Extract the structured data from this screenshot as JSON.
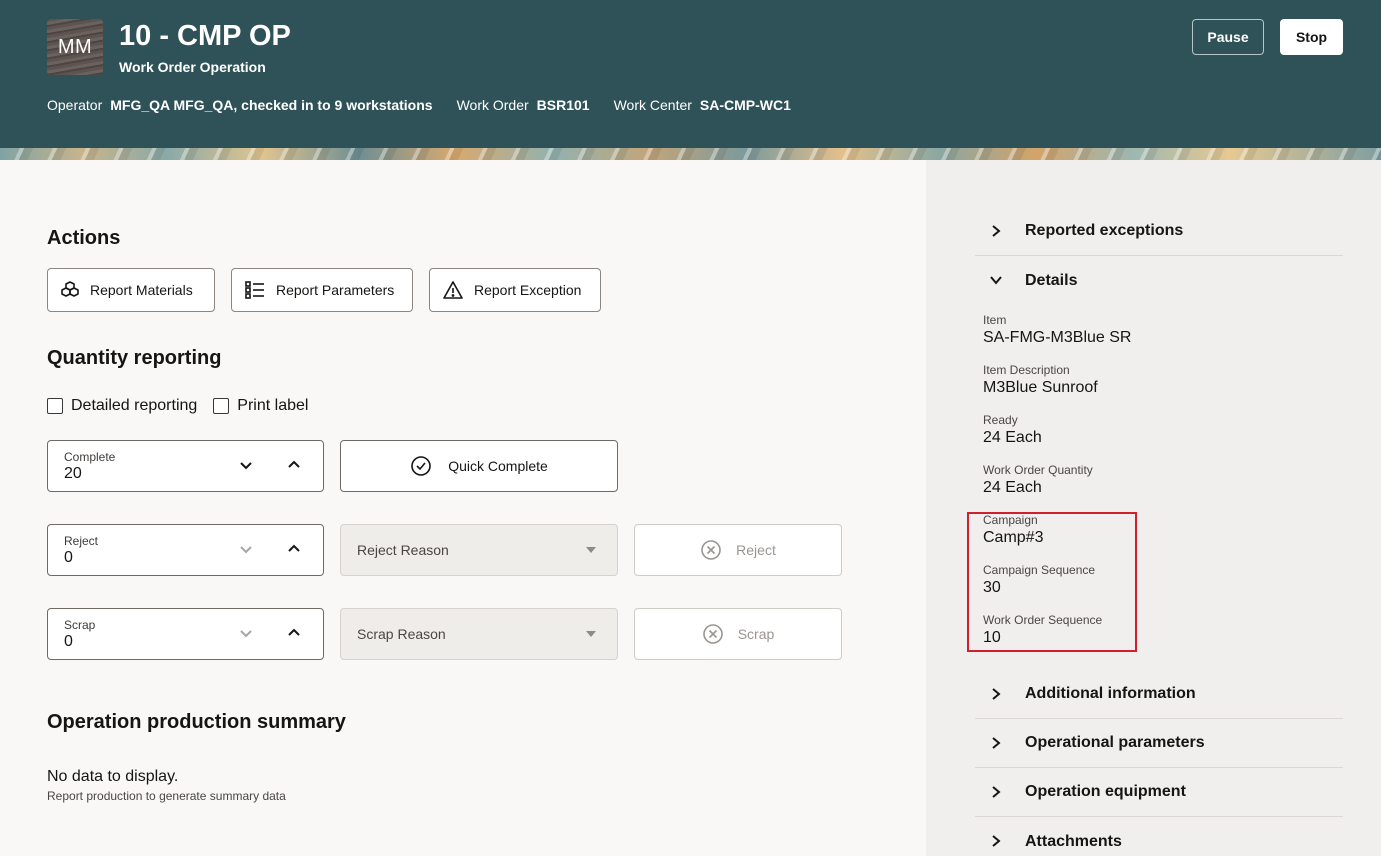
{
  "header": {
    "avatar_initials": "MM",
    "title": "10 - CMP OP",
    "subtitle": "Work Order Operation",
    "operator_label": "Operator",
    "operator_value": "MFG_QA MFG_QA, checked in to 9 workstations",
    "work_order_label": "Work Order",
    "work_order_value": "BSR101",
    "work_center_label": "Work Center",
    "work_center_value": "SA-CMP-WC1",
    "pause_label": "Pause",
    "stop_label": "Stop",
    "background_color": "#2f5258"
  },
  "actions": {
    "title": "Actions",
    "report_materials": "Report Materials",
    "report_parameters": "Report Parameters",
    "report_exception": "Report Exception"
  },
  "quantity": {
    "title": "Quantity reporting",
    "detailed_reporting": "Detailed reporting",
    "print_label": "Print label",
    "complete_label": "Complete",
    "complete_value": "20",
    "quick_complete": "Quick Complete",
    "reject_label": "Reject",
    "reject_value": "0",
    "reject_reason_placeholder": "Reject Reason",
    "reject_button": "Reject",
    "scrap_label": "Scrap",
    "scrap_value": "0",
    "scrap_reason_placeholder": "Scrap Reason",
    "scrap_button": "Scrap"
  },
  "summary": {
    "title": "Operation production summary",
    "no_data": "No data to display.",
    "no_data_hint": "Report production to generate summary data"
  },
  "side": {
    "reported_exceptions": "Reported exceptions",
    "details": "Details",
    "fields": [
      {
        "label": "Item",
        "value": "SA-FMG-M3Blue SR"
      },
      {
        "label": "Item Description",
        "value": "M3Blue Sunroof"
      },
      {
        "label": "Ready",
        "value": "24 Each"
      },
      {
        "label": "Work Order Quantity",
        "value": "24 Each"
      },
      {
        "label": "Campaign",
        "value": "Camp#3"
      },
      {
        "label": "Campaign Sequence",
        "value": "30"
      },
      {
        "label": "Work Order Sequence",
        "value": "10"
      }
    ],
    "additional_information": "Additional information",
    "operational_parameters": "Operational parameters",
    "operation_equipment": "Operation equipment",
    "attachments": "Attachments",
    "highlight_color": "#d0202e"
  }
}
